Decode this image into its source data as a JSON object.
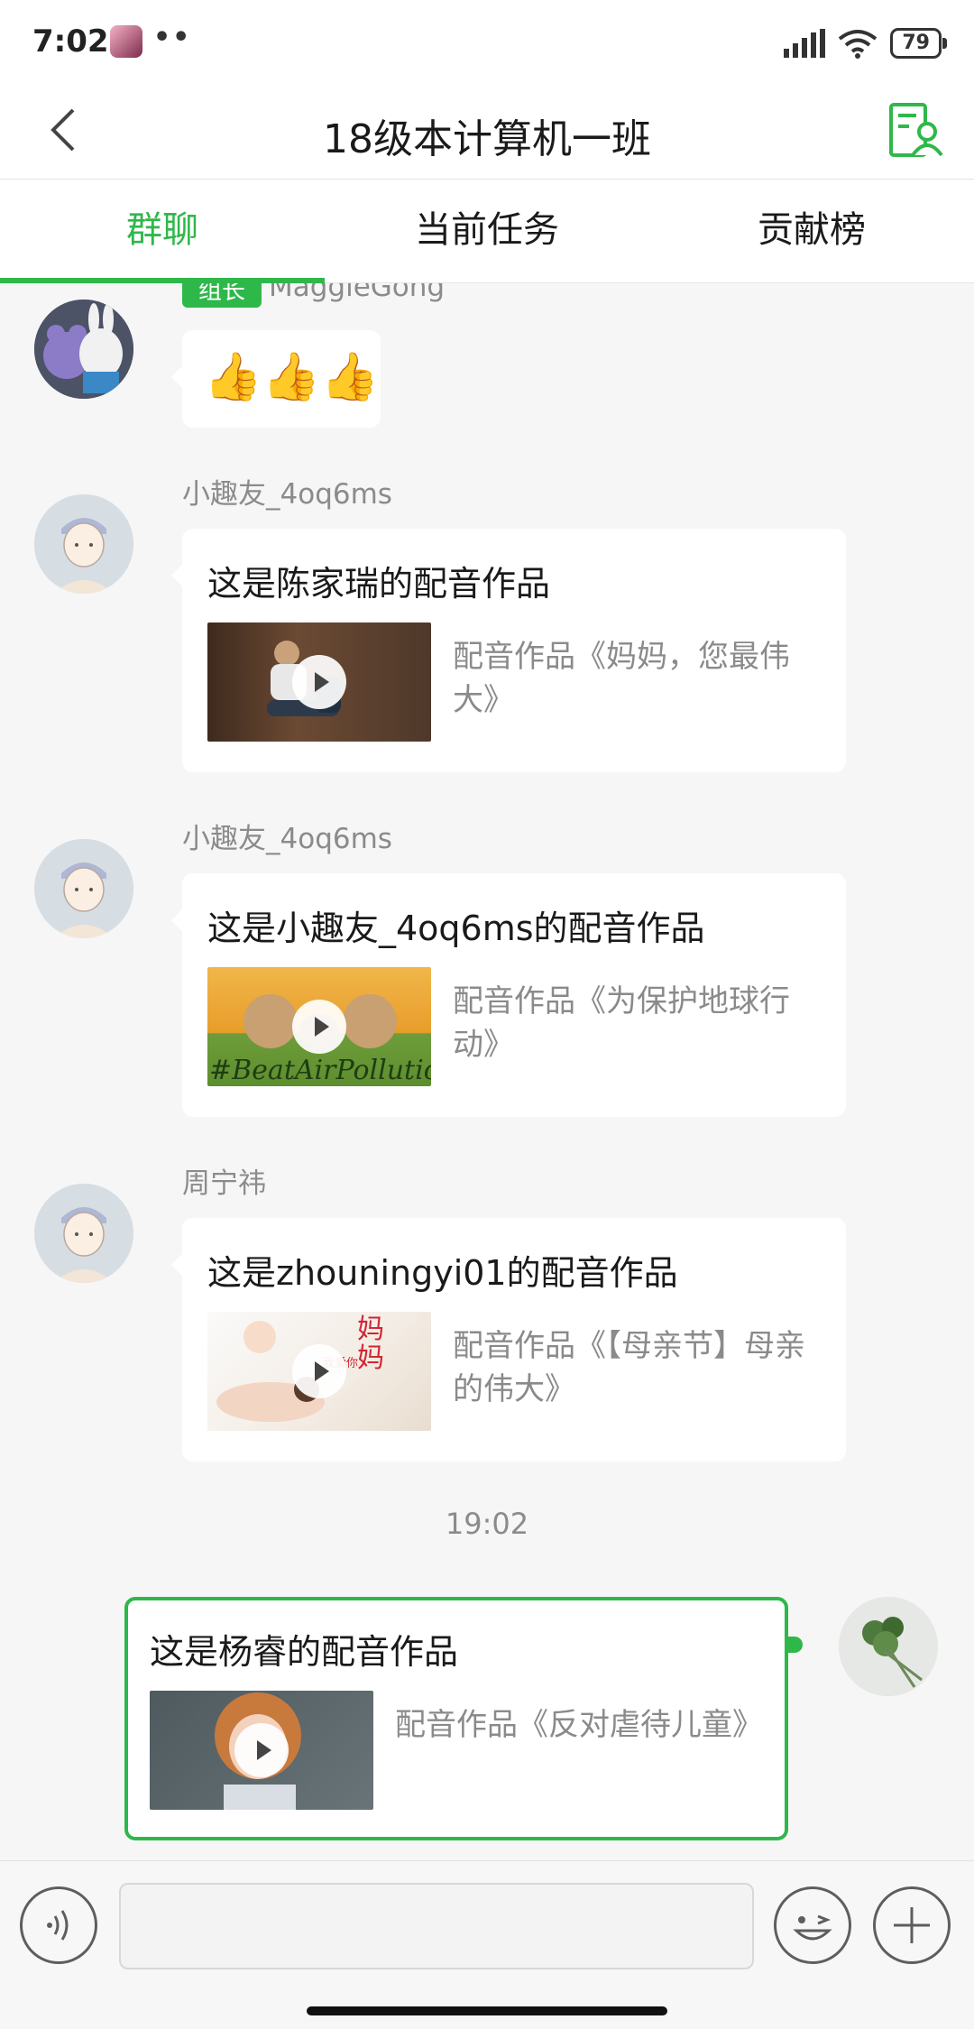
{
  "status_bar": {
    "time": "7:02",
    "dots": "••",
    "battery": "79"
  },
  "header": {
    "title": "18级本计算机一班"
  },
  "tabs": [
    {
      "label": "群聊",
      "active": true
    },
    {
      "label": "当前任务",
      "active": false
    },
    {
      "label": "贡献榜",
      "active": false
    }
  ],
  "first_message": {
    "role_badge": "组长",
    "sender": "MaggieGong",
    "emoji": "👍👍👍"
  },
  "messages": [
    {
      "sender": "小趣友_4oq6ms",
      "title": "这是陈家瑞的配音作品",
      "description": "配音作品《妈妈，您最伟大》"
    },
    {
      "sender": "小趣友_4oq6ms",
      "title": "这是小趣友_4oq6ms的配音作品",
      "description": "配音作品《为保护地球行动》",
      "thumb_text": "#BeatAirPollution"
    },
    {
      "sender": "周宁祎",
      "title": "这是zhouningyi01的配音作品",
      "description": "配音作品《【母亲节】母亲的伟大》",
      "thumb_text_big": "妈妈",
      "thumb_text_small": "我爱你"
    }
  ],
  "timestamp": "19:02",
  "my_message": {
    "title": "这是杨睿的配音作品",
    "description": "配音作品《反对虐待儿童》"
  },
  "input": {
    "placeholder": ""
  },
  "colors": {
    "accent": "#2eb84a",
    "background": "#f6f6f6"
  }
}
